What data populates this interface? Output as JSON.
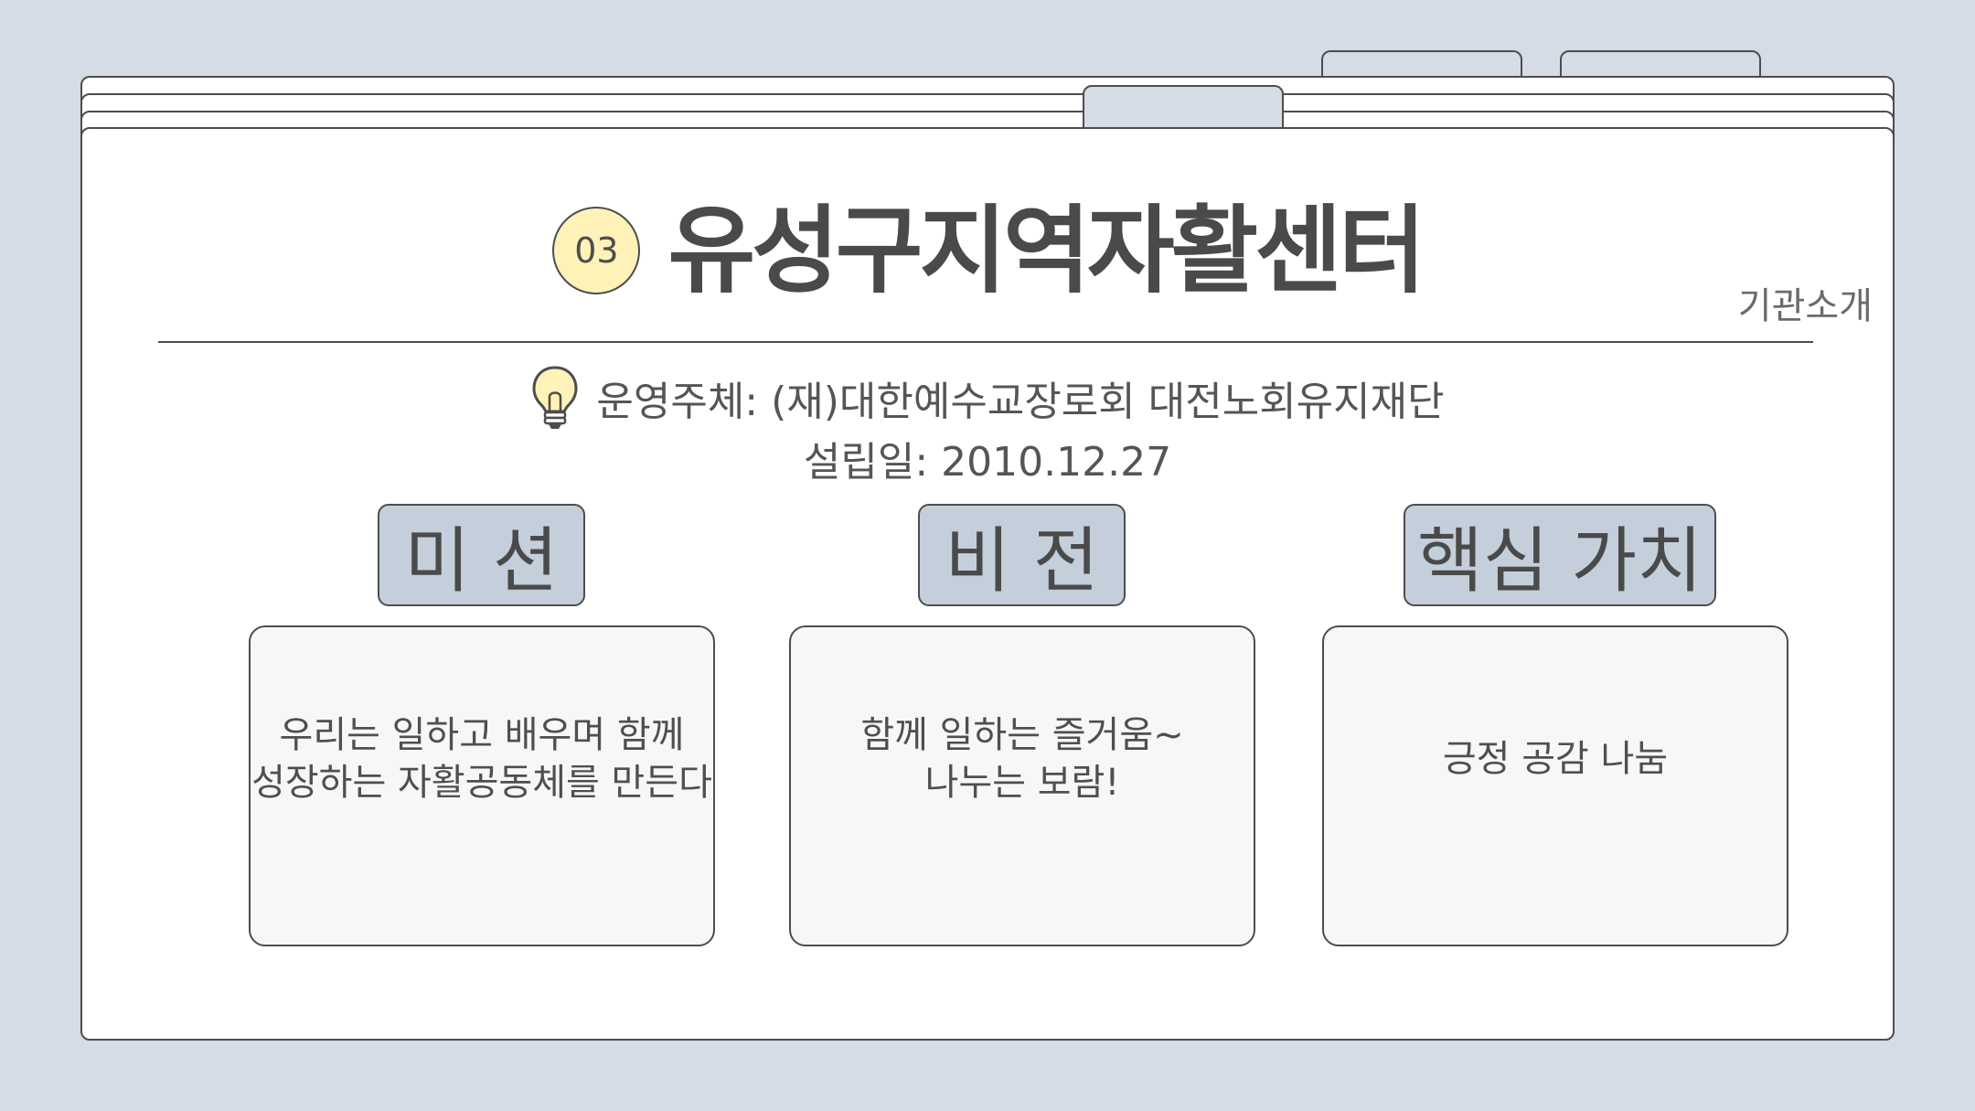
{
  "header": {
    "number": "03",
    "title": "유성구지역자활센터",
    "section_label": "기관소개"
  },
  "info": {
    "icon": "lightbulb-icon",
    "operator": "운영주체: (재)대한예수교장로회 대전노회유지재단",
    "founded": "설립일: 2010.12.27"
  },
  "sections": [
    {
      "heading": "미 션",
      "lines": [
        "우리는 일하고 배우며 함께",
        "성장하는 자활공동체를 만든다"
      ]
    },
    {
      "heading": "비 전",
      "lines": [
        "함께 일하는 즐거움~",
        "나누는 보람!"
      ]
    },
    {
      "heading": "핵심 가치",
      "lines": [
        "긍정 공감 나눔"
      ]
    }
  ],
  "colors": {
    "background": "#d5dce5",
    "badge": "#fff2b8",
    "heading_box": "#c5cfdb",
    "card": "#f7f7f7",
    "outline": "#4d4d4d"
  }
}
